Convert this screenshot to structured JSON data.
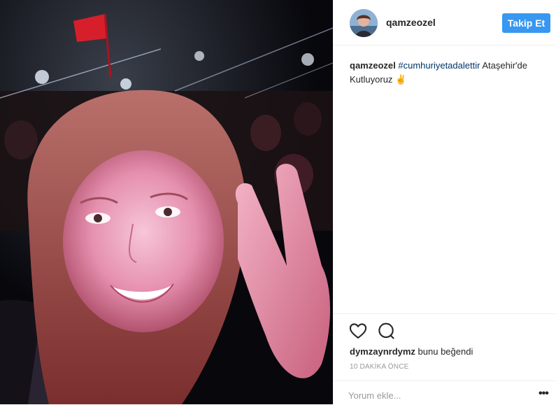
{
  "post": {
    "photo_alt": "selfie photo at night crowd",
    "username": "qamzeozel",
    "follow_label": "Takip Et",
    "caption": {
      "author": "qamzeozel",
      "hashtag": "#cumhuriyetadalettir",
      "text_after": " Ataşehir'de Kutluyoruz ✌"
    },
    "likes": {
      "liker": "dymzaynrdymz",
      "suffix": " bunu beğendi"
    },
    "timestamp": "10 DAKİKA ÖNCE",
    "comment_placeholder": "Yorum ekle...",
    "more_label": "•••"
  },
  "colors": {
    "follow_button": "#3897f0",
    "hashtag": "#003569",
    "muted_text": "#999999"
  },
  "icons": {
    "like": "heart-icon",
    "comment": "comment-bubble-icon",
    "more": "more-options-icon"
  }
}
